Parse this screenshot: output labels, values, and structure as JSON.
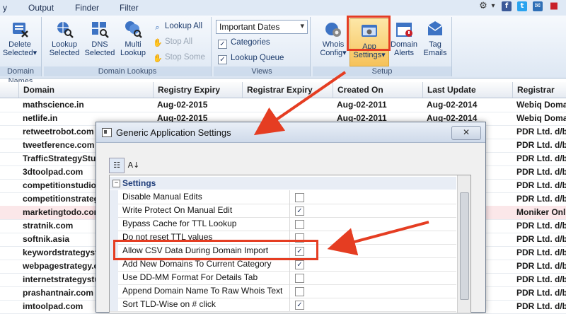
{
  "menu": {
    "items": [
      "y",
      "Output",
      "Finder",
      "Filter"
    ],
    "icons": {
      "gear": "gear-icon",
      "dropdown": "chevron-down-icon",
      "facebook": "facebook-icon",
      "twitter": "twitter-icon",
      "email": "envelope-icon",
      "box": "cube-icon"
    },
    "icon_glyphs": {
      "facebook": "f",
      "twitter": "t",
      "email": "✉",
      "box": "■",
      "gear": "⚙",
      "dropdown": "▾"
    }
  },
  "ribbon": {
    "group_domain_names": {
      "label": "Domain Names",
      "delete_label_1": "Delete",
      "delete_label_2": "Selected",
      "delete_arrow": "▾"
    },
    "group_domain_lookups": {
      "label": "Domain Lookups",
      "lookup_selected_1": "Lookup",
      "lookup_selected_2": "Selected",
      "dns_selected_1": "DNS",
      "dns_selected_2": "Selected",
      "multi_lookup_1": "Multi",
      "multi_lookup_2": "Lookup",
      "lookup_all": "Lookup All",
      "stop_all": "Stop All",
      "stop_some": "Stop Some"
    },
    "group_views": {
      "label": "Views",
      "dropdown_value": "Important Dates",
      "categories": "Categories",
      "lookup_queue": "Lookup Queue",
      "categories_checked": true,
      "lookup_queue_checked": true
    },
    "group_setup": {
      "label": "Setup",
      "whois_config_1": "Whois",
      "whois_config_2": "Config",
      "app_settings_1": "App",
      "app_settings_2": "Settings",
      "domain_alerts_1": "Domain",
      "domain_alerts_2": "Alerts",
      "tag_emails_1": "Tag",
      "tag_emails_2": "Emails",
      "arrow": "▾"
    }
  },
  "grid": {
    "columns": [
      "Domain",
      "Registry Expiry",
      "Registrar Expiry",
      "Created On",
      "Last Update",
      "Registrar"
    ],
    "rows": [
      {
        "domain": "mathscience.in",
        "registry_expiry": "Aug-02-2015",
        "registrar_expiry": "",
        "created_on": "Aug-02-2011",
        "last_update": "Aug-02-2014",
        "registrar": "Webiq Domains"
      },
      {
        "domain": "netlife.in",
        "registry_expiry": "Aug-02-2015",
        "registrar_expiry": "",
        "created_on": "Aug-02-2011",
        "last_update": "Aug-02-2014",
        "registrar": "Webiq Domains"
      },
      {
        "domain": "retweetrobot.com",
        "registry_expiry": "",
        "registrar_expiry": "",
        "created_on": "",
        "last_update": "",
        "registrar": "PDR Ltd. d/b/a"
      },
      {
        "domain": "tweetference.com",
        "registry_expiry": "",
        "registrar_expiry": "",
        "created_on": "",
        "last_update": "",
        "registrar": "PDR Ltd. d/b/a"
      },
      {
        "domain": "TrafficStrategyStudio.com",
        "registry_expiry": "",
        "registrar_expiry": "",
        "created_on": "",
        "last_update": "",
        "registrar": "PDR Ltd. d/b/a"
      },
      {
        "domain": "3dtoolpad.com",
        "registry_expiry": "",
        "registrar_expiry": "",
        "created_on": "",
        "last_update": "",
        "registrar": "PDR Ltd. d/b/a"
      },
      {
        "domain": "competitionstudio.com",
        "registry_expiry": "",
        "registrar_expiry": "",
        "created_on": "",
        "last_update": "",
        "registrar": "PDR Ltd. d/b/a"
      },
      {
        "domain": "competitionstrategy.com",
        "registry_expiry": "",
        "registrar_expiry": "",
        "created_on": "",
        "last_update": "",
        "registrar": "PDR Ltd. d/b/a"
      },
      {
        "domain": "marketingtodo.com",
        "registry_expiry": "",
        "registrar_expiry": "",
        "created_on": "",
        "last_update": "",
        "registrar": "Moniker Online"
      },
      {
        "domain": "stratnik.com",
        "registry_expiry": "",
        "registrar_expiry": "",
        "created_on": "",
        "last_update": "",
        "registrar": "PDR Ltd. d/b/a"
      },
      {
        "domain": "softnik.asia",
        "registry_expiry": "",
        "registrar_expiry": "",
        "created_on": "",
        "last_update": "",
        "registrar": "PDR Ltd. d/b/a"
      },
      {
        "domain": "keywordstrategystudio.com",
        "registry_expiry": "",
        "registrar_expiry": "",
        "created_on": "",
        "last_update": "",
        "registrar": "PDR Ltd. d/b/a"
      },
      {
        "domain": "webpagestrategy.com",
        "registry_expiry": "",
        "registrar_expiry": "",
        "created_on": "",
        "last_update": "",
        "registrar": "PDR Ltd. d/b/a"
      },
      {
        "domain": "internetstrategystudio.com",
        "registry_expiry": "",
        "registrar_expiry": "",
        "created_on": "",
        "last_update": "",
        "registrar": "PDR Ltd. d/b/a"
      },
      {
        "domain": "prashantnair.com",
        "registry_expiry": "",
        "registrar_expiry": "",
        "created_on": "",
        "last_update": "",
        "registrar": "PDR Ltd. d/b/a"
      },
      {
        "domain": "imtoolpad.com",
        "registry_expiry": "",
        "registrar_expiry": "",
        "created_on": "",
        "last_update": "",
        "registrar": "PDR Ltd. d/b/a"
      }
    ],
    "highlighted_row_index": 8
  },
  "dialog": {
    "title": "Generic Application Settings",
    "close_glyph": "✕",
    "toolbar": {
      "categorized_glyph": "☷",
      "alpha_glyph": "A↓"
    },
    "category": {
      "label": "Settings",
      "toggle": "−"
    },
    "check_glyph": "✓",
    "settings": [
      {
        "name": "Disable Manual Edits",
        "checked": false
      },
      {
        "name": "Write Protect On Manual Edit",
        "checked": true
      },
      {
        "name": "Bypass Cache for TTL Lookup",
        "checked": false
      },
      {
        "name": "Do not reset TTL values",
        "checked": false
      },
      {
        "name": "Allow CSV Data During Domain Import",
        "checked": true
      },
      {
        "name": "Add New Domains To Current Category",
        "checked": true
      },
      {
        "name": "Use DD-MM Format For Details Tab",
        "checked": false
      },
      {
        "name": "Append Domain Name To Raw Whois Text",
        "checked": false
      },
      {
        "name": "Sort TLD-Wise on # click",
        "checked": true
      }
    ]
  },
  "colors": {
    "annotation": "#e53d22",
    "ribbon_selected": "#f6c25a",
    "highlight_row": "#fbe7e9"
  }
}
